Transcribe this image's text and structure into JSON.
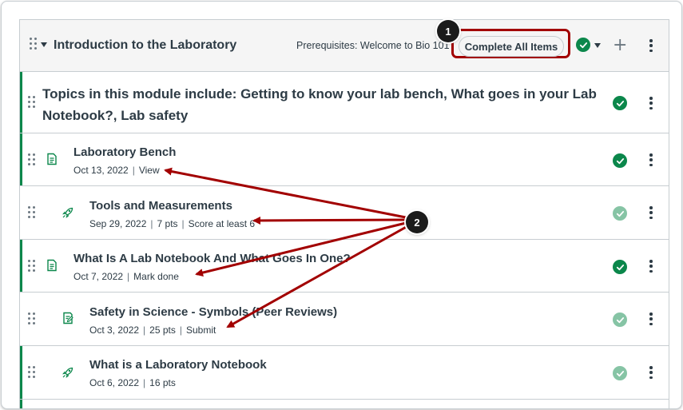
{
  "module": {
    "title": "Introduction to the Laboratory",
    "prerequisites": "Prerequisites: Welcome to Bio 101",
    "complete_all_label": "Complete All Items",
    "status_icon": "check-circle-icon",
    "add_icon": "plus-icon",
    "menu_icon": "kebab-icon"
  },
  "subheader": {
    "text": "Topics in this module include: Getting to know your lab bench, What goes in your Lab Notebook?, Lab safety"
  },
  "items": [
    {
      "title": "Laboratory Bench",
      "date": "Oct 13, 2022",
      "points": "",
      "requirement": "View",
      "icon": "page-icon",
      "published": "published"
    },
    {
      "title": "Tools and Measurements",
      "date": "Sep 29, 2022",
      "points": "7 pts",
      "requirement": "Score at least 6",
      "icon": "quiz-rocket-icon",
      "published": "unpublished"
    },
    {
      "title": "What Is A Lab Notebook And What Goes In One?",
      "date": "Oct 7, 2022",
      "points": "",
      "requirement": "Mark done",
      "icon": "page-icon",
      "published": "published"
    },
    {
      "title": "Safety in Science - Symbols (Peer Reviews)",
      "date": "Oct 3, 2022",
      "points": "25 pts",
      "requirement": "Submit",
      "icon": "assignment-icon",
      "published": "unpublished"
    },
    {
      "title": "What is a Laboratory Notebook",
      "date": "Oct 6, 2022",
      "points": "16 pts",
      "requirement": "",
      "icon": "quiz-rocket-icon",
      "published": "unpublished"
    }
  ],
  "callouts": {
    "one": "1",
    "two": "2"
  },
  "colors": {
    "published_green": "#0b874b",
    "callout_red": "#a20000",
    "text": "#2d3b45"
  }
}
